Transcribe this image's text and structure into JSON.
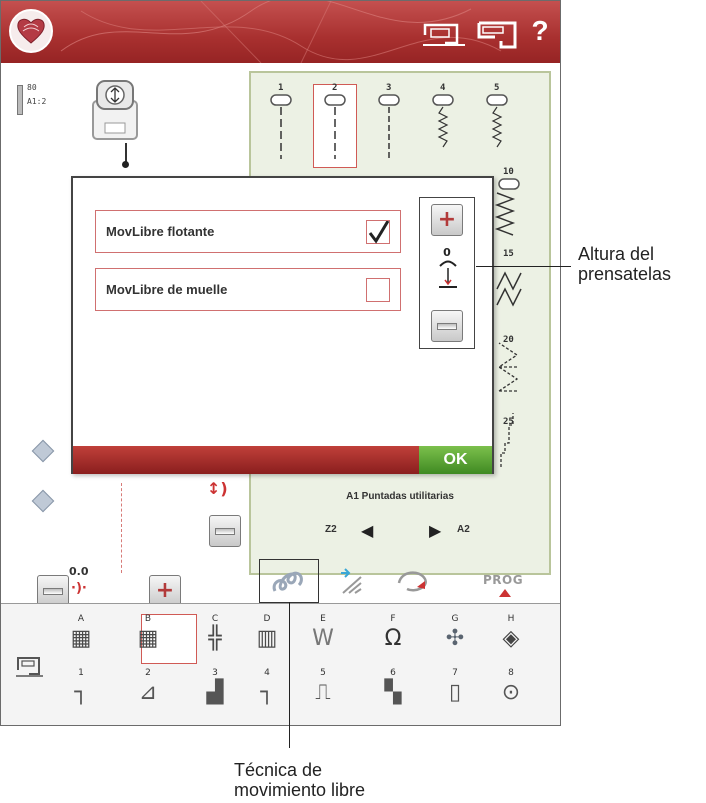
{
  "topbar": {
    "logo_icon": "heart-logo-icon",
    "help_label": "?",
    "icons": [
      "sewing-machine-icon",
      "sewing-machine-icon"
    ]
  },
  "left_panel": {
    "needle_info_line1": "80",
    "needle_info_line2": "A1:2",
    "stitch_length_value": "0.0"
  },
  "stitch_panel": {
    "numbers": [
      "1",
      "2",
      "3",
      "4",
      "5",
      "10",
      "15",
      "20",
      "25"
    ],
    "selected_stitch": "2",
    "menu_label": "A1 Puntadas utilitarias",
    "nav_left_label": "Z2",
    "nav_right_label": "A2"
  },
  "dialog": {
    "option1_label": "MovLibre flotante",
    "option1_checked": true,
    "option2_label": "MovLibre de muelle",
    "option2_checked": false,
    "presser_height_value": "0",
    "ok_label": "OK"
  },
  "toolbar": {
    "prog_label": "PROG"
  },
  "categories": {
    "letters": [
      "A",
      "B",
      "C",
      "D",
      "E",
      "F",
      "G",
      "H"
    ],
    "numbers": [
      "1",
      "2",
      "3",
      "4",
      "5",
      "6",
      "7",
      "8"
    ],
    "selected_letter": "B"
  },
  "callouts": {
    "presser_line1": "Altura del",
    "presser_line2": "prensatelas",
    "freemotion_line1": "Técnica de",
    "freemotion_line2": "movimiento libre"
  },
  "colors": {
    "topbar_red": "#a8302f",
    "ok_green": "#4f9a2c",
    "panel_green": "#ecf1e4"
  }
}
